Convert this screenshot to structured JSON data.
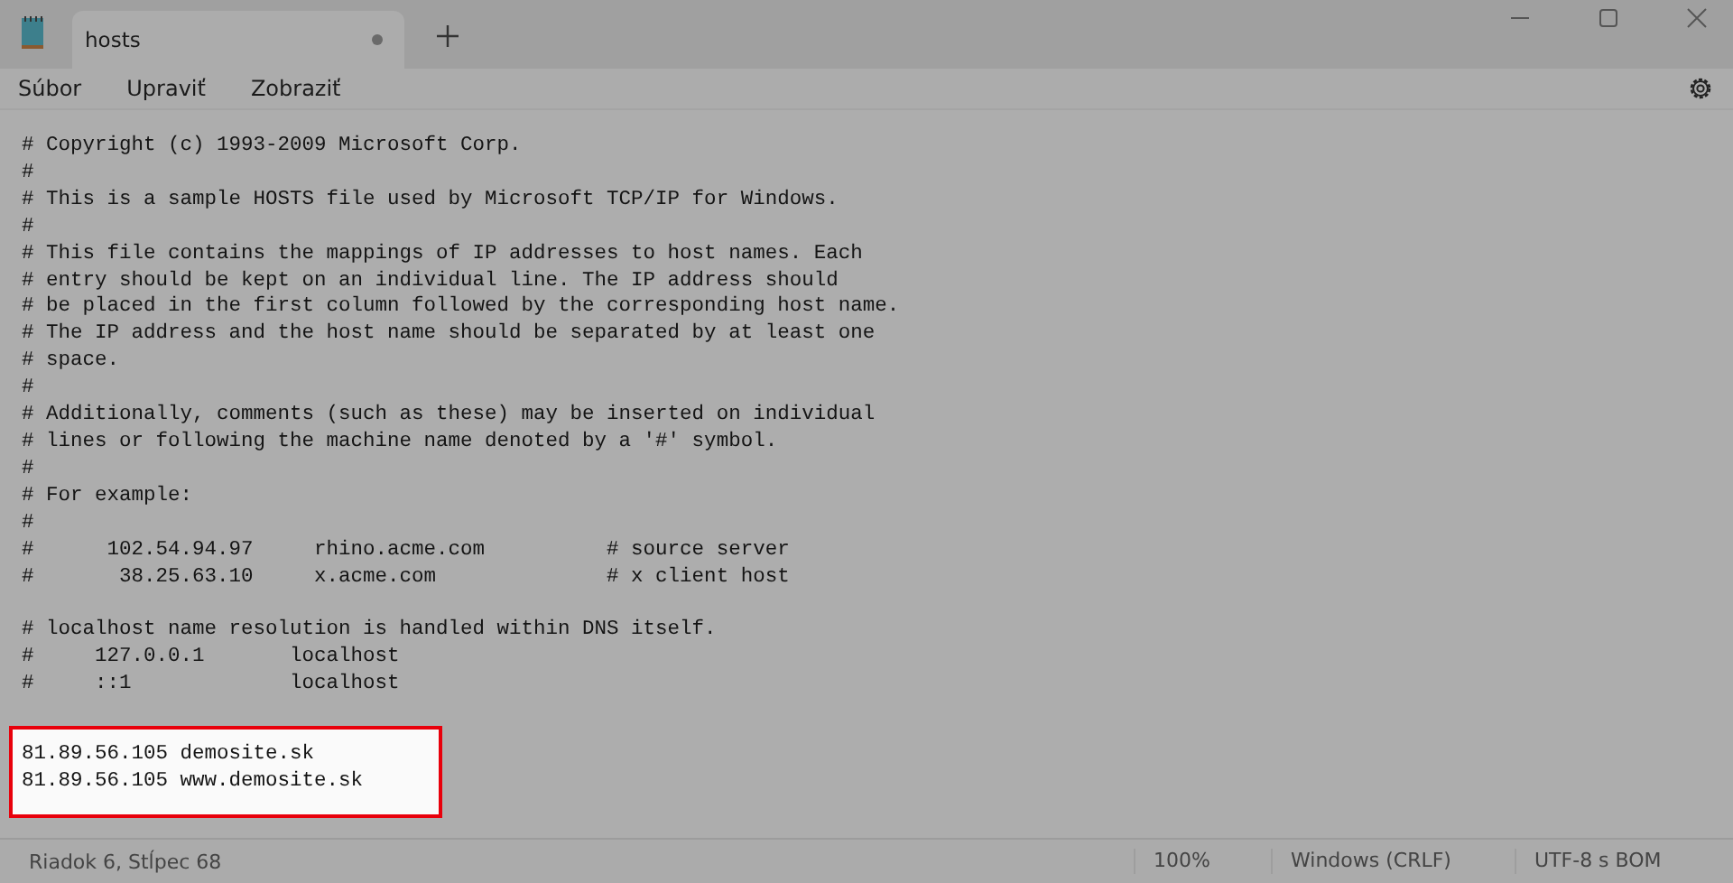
{
  "tabs": [
    {
      "label": "hosts",
      "selected": true,
      "modified": true
    }
  ],
  "menu": [
    "Súbor",
    "Upraviť",
    "Zobraziť"
  ],
  "editor": {
    "blocks": [
      {
        "highlighted": false,
        "lines": [
          "# Copyright (c) 1993-2009 Microsoft Corp.",
          "#",
          "# This is a sample HOSTS file used by Microsoft TCP/IP for Windows.",
          "#",
          "# This file contains the mappings of IP addresses to host names. Each",
          "# entry should be kept on an individual line. The IP address should",
          "# be placed in the first column followed by the corresponding host name.",
          "# The IP address and the host name should be separated by at least one",
          "# space.",
          "#",
          "# Additionally, comments (such as these) may be inserted on individual",
          "# lines or following the machine name denoted by a '#' symbol.",
          "#",
          "# For example:",
          "#",
          "#      102.54.94.97     rhino.acme.com          # source server",
          "#       38.25.63.10     x.acme.com              # x client host"
        ]
      },
      {
        "highlighted": false,
        "lines": [
          "# localhost name resolution is handled within DNS itself.",
          "#     127.0.0.1       localhost",
          "#     ::1             localhost"
        ]
      },
      {
        "highlighted": true,
        "lines": [
          "81.89.56.105 demosite.sk",
          "81.89.56.105 www.demosite.sk"
        ]
      }
    ]
  },
  "status_bar": {
    "position": "Riadok 6, Stĺpec 68",
    "zoom": "100%",
    "line_endings": "Windows (CRLF)",
    "encoding": "UTF-8 s BOM"
  }
}
